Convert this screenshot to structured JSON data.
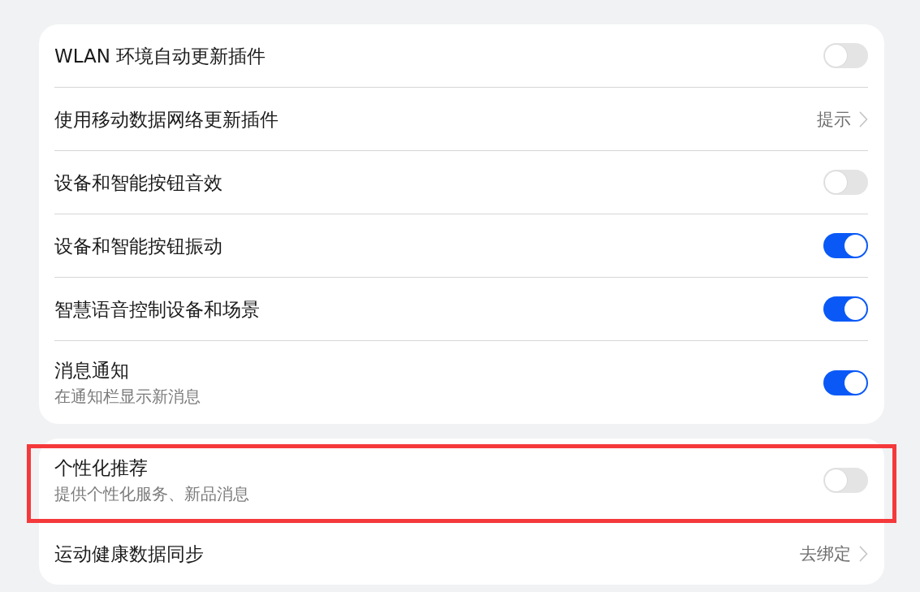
{
  "groups": [
    {
      "items": [
        {
          "kind": "toggle",
          "title": "WLAN 环境自动更新插件",
          "on": false,
          "highlighted": false
        },
        {
          "kind": "link",
          "title": "使用移动数据网络更新插件",
          "value": "提示",
          "highlighted": false
        },
        {
          "kind": "toggle",
          "title": "设备和智能按钮音效",
          "on": false,
          "highlighted": false
        },
        {
          "kind": "toggle",
          "title": "设备和智能按钮振动",
          "on": true,
          "highlighted": false
        },
        {
          "kind": "toggle",
          "title": "智慧语音控制设备和场景",
          "on": true,
          "highlighted": false
        },
        {
          "kind": "toggle",
          "title": "消息通知",
          "subtitle": "在通知栏显示新消息",
          "on": true,
          "highlighted": false
        }
      ]
    },
    {
      "items": [
        {
          "kind": "toggle",
          "title": "个性化推荐",
          "subtitle": "提供个性化服务、新品消息",
          "on": false,
          "highlighted": true
        },
        {
          "kind": "link",
          "title": "运动健康数据同步",
          "value": "去绑定",
          "highlighted": false
        }
      ]
    }
  ]
}
